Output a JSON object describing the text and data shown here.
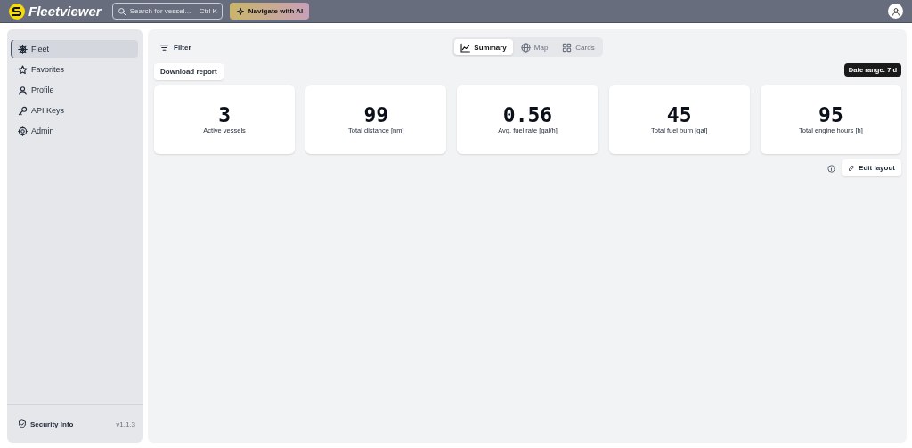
{
  "header": {
    "app_name": "Fleetviewer",
    "search": {
      "placeholder": "Search for vessel...",
      "shortcut": "Ctrl K"
    },
    "ai_button": "Navigate with AI"
  },
  "sidebar": {
    "items": [
      {
        "label": "Fleet",
        "selected": true
      },
      {
        "label": "Favorites",
        "selected": false
      },
      {
        "label": "Profile",
        "selected": false
      },
      {
        "label": "API Keys",
        "selected": false
      },
      {
        "label": "Admin",
        "selected": false
      }
    ],
    "footer": {
      "link": "Security Info",
      "version": "v1.1.3"
    }
  },
  "toolbar": {
    "filter": "Filter",
    "tabs": [
      {
        "label": "Summary",
        "selected": true
      },
      {
        "label": "Map",
        "selected": false
      },
      {
        "label": "Cards",
        "selected": false
      }
    ],
    "download": "Download report",
    "date_range": "Date range: 7 d"
  },
  "stats": [
    {
      "value": "3",
      "label": "Active vessels"
    },
    {
      "value": "99",
      "label": "Total distance [nm]"
    },
    {
      "value": "0.56",
      "label": "Avg. fuel rate [gal/h]"
    },
    {
      "value": "45",
      "label": "Total fuel burn [gal]"
    },
    {
      "value": "95",
      "label": "Total engine hours [h]"
    }
  ],
  "edit_layout": "Edit layout"
}
